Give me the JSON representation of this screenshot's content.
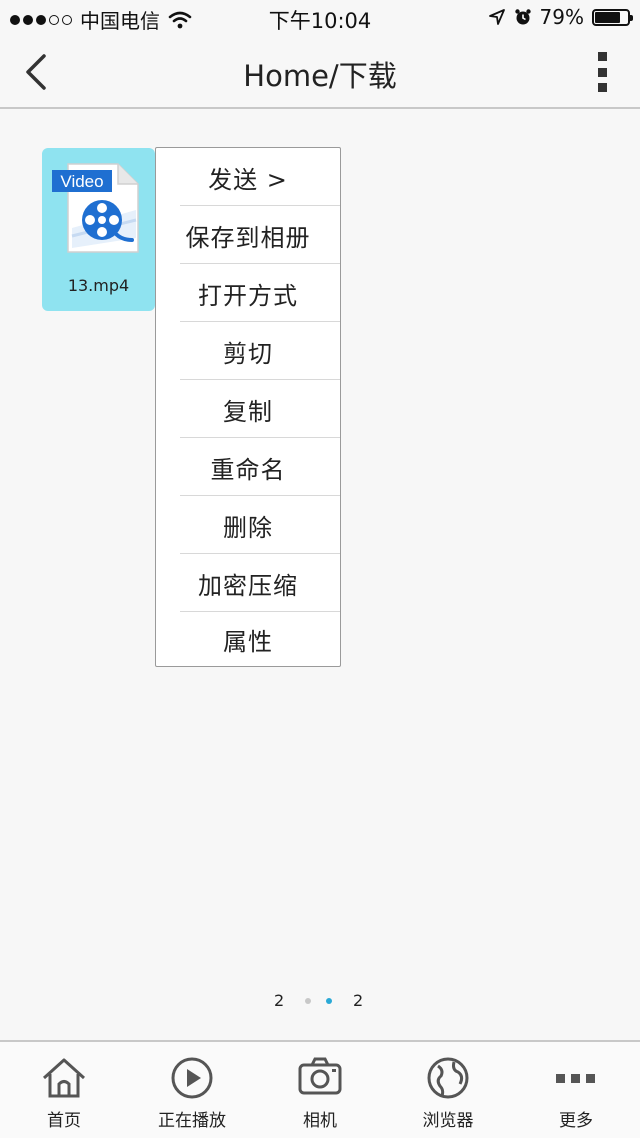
{
  "status_bar": {
    "carrier": "中国电信",
    "time": "下午10:04",
    "battery_text": "79%",
    "battery_level": 0.79,
    "signal_bars_filled": 3,
    "signal_bars_total": 5
  },
  "nav": {
    "title": "Home/下载",
    "back_icon": "chevron-left-icon",
    "more_icon": "vertical-dots-icon"
  },
  "file": {
    "name": "13.mp4",
    "icon_label": "Video",
    "icon": "video-file-icon"
  },
  "context_menu": {
    "items": [
      {
        "label": "发送 >"
      },
      {
        "label": "保存到相册"
      },
      {
        "label": "打开方式"
      },
      {
        "label": "剪切"
      },
      {
        "label": "复制"
      },
      {
        "label": "重命名"
      },
      {
        "label": "删除"
      },
      {
        "label": "加密压缩"
      },
      {
        "label": "属性"
      }
    ]
  },
  "pager": {
    "left": "2",
    "right": "2",
    "active_color": "#2aa9d6",
    "inactive_color": "#c8c8c8"
  },
  "tabs": [
    {
      "label": "首页",
      "icon": "home-icon"
    },
    {
      "label": "正在播放",
      "icon": "play-icon"
    },
    {
      "label": "相机",
      "icon": "camera-icon"
    },
    {
      "label": "浏览器",
      "icon": "globe-icon"
    },
    {
      "label": "更多",
      "icon": "more-dots-icon"
    }
  ],
  "colors": {
    "accent": "#2aa9d6",
    "tile": "#8fe3f0",
    "video_blue": "#1f6fd1"
  }
}
